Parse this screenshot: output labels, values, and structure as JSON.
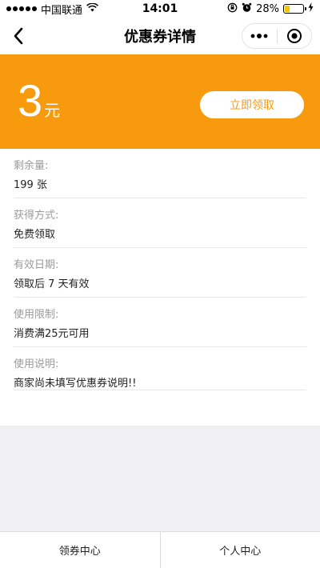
{
  "status_bar": {
    "carrier": "中国联通",
    "time": "14:01",
    "battery": "28%",
    "battery_level": 0.28
  },
  "nav": {
    "title": "优惠券详情"
  },
  "coupon": {
    "amount": "3",
    "unit": "元",
    "claim_label": "立即领取"
  },
  "details": [
    {
      "label": "剩余量:",
      "value": "199 张"
    },
    {
      "label": "获得方式:",
      "value": "免费领取"
    },
    {
      "label": "有效日期:",
      "value": "领取后 7 天有效"
    },
    {
      "label": "使用限制:",
      "value": "消费满25元可用"
    },
    {
      "label": "使用说明:",
      "value": "商家尚未填写优惠券说明!!"
    }
  ],
  "tabs": [
    {
      "label": "领券中心"
    },
    {
      "label": "个人中心"
    }
  ],
  "colors": {
    "accent": "#f79a0e",
    "battery": "#f5c400"
  }
}
